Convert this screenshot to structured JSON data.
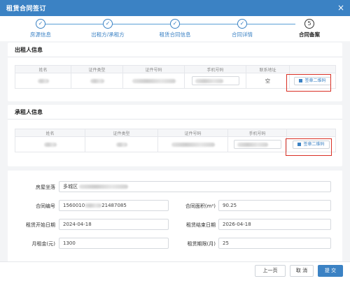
{
  "dialog": {
    "title": "租赁合同签订",
    "close_glyph": "×"
  },
  "steps": [
    {
      "label": "房源信息",
      "glyph": "✓",
      "state": "done"
    },
    {
      "label": "出租方/承租方",
      "glyph": "✓",
      "state": "done"
    },
    {
      "label": "租赁合同信息",
      "glyph": "✓",
      "state": "done"
    },
    {
      "label": "合同详情",
      "glyph": "✓",
      "state": "done"
    },
    {
      "label": "合同备案",
      "glyph": "5",
      "state": "current"
    }
  ],
  "lessor": {
    "title": "出租人信息",
    "columns": [
      "姓名",
      "证件类型",
      "证件号码",
      "手机号码",
      "联系地址",
      ""
    ],
    "row": {
      "address": "空",
      "sign_label": "签章二维码"
    }
  },
  "lessee": {
    "title": "承租人信息",
    "columns": [
      "姓名",
      "证件类型",
      "证件号码",
      "手机号码",
      ""
    ],
    "row": {
      "sign_label": "签章二维码"
    }
  },
  "form": {
    "address_label": "房屋坐落",
    "address_value": "多城区",
    "contract_no_label": "合同编号",
    "contract_no_prefix": "1560010",
    "contract_no_suffix": "21487085",
    "area_label": "合同面积(m²)",
    "area_value": "90.25",
    "start_label": "租赁开始日期",
    "start_value": "2024-04-18",
    "end_label": "租赁结束日期",
    "end_value": "2026-04-18",
    "rent_label": "月租金(元)",
    "rent_value": "1300",
    "period_label": "租赁期限(月)",
    "period_value": "25"
  },
  "footer": {
    "prev_label": "上一页",
    "cancel_label": "取 消",
    "submit_label": "提 交"
  },
  "colors": {
    "primary": "#3b82c4",
    "highlight": "#d93025"
  }
}
